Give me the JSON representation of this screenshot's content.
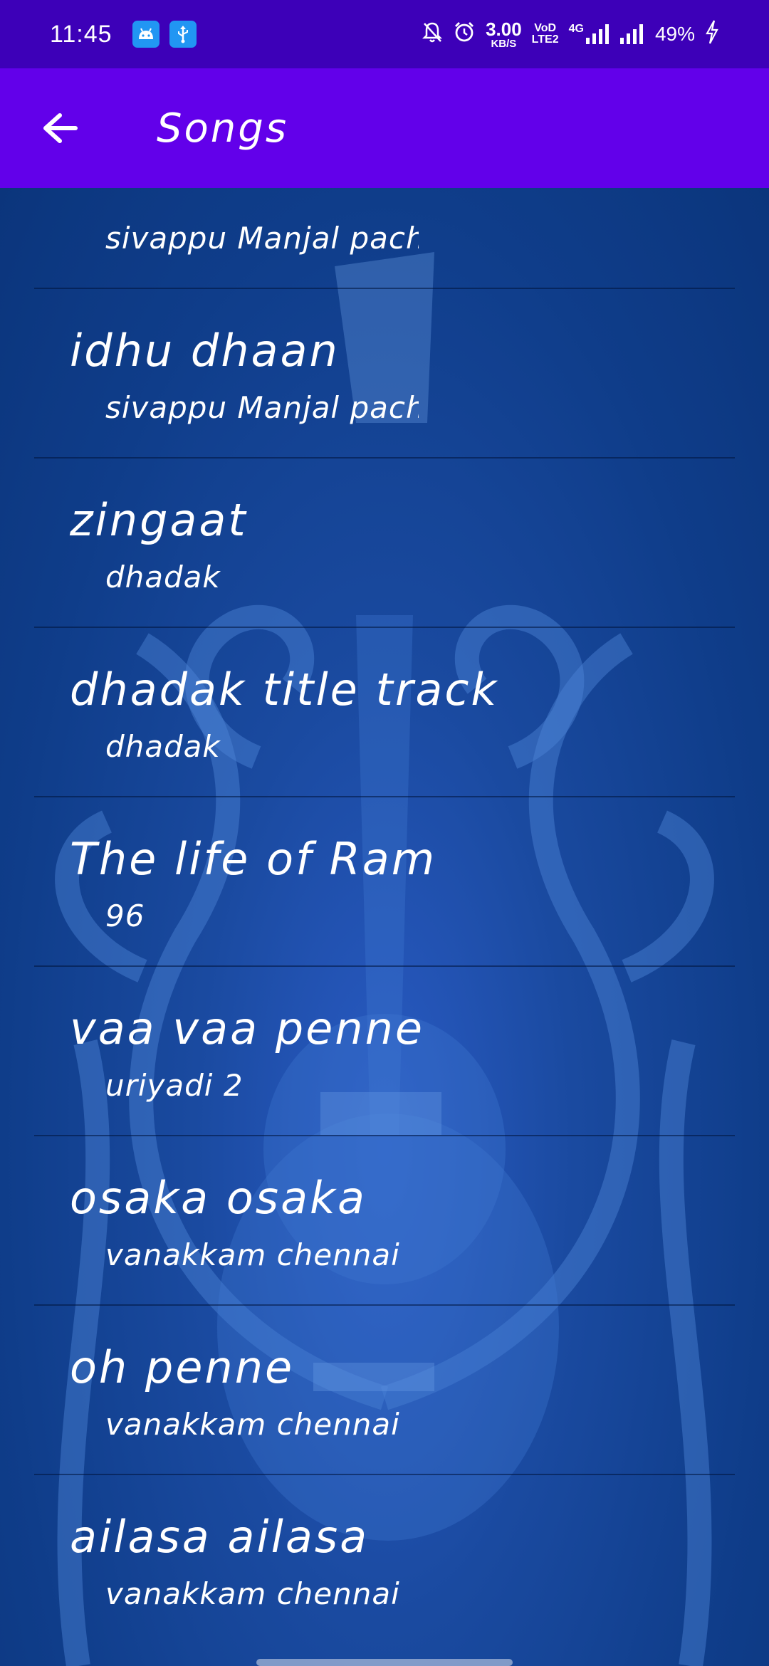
{
  "status_bar": {
    "time": "11:45",
    "speed_value": "3.00",
    "speed_unit": "KB/S",
    "volte_top": "VoD",
    "volte_bottom": "LTE2",
    "network": "4G",
    "battery": "49%",
    "icons": [
      "android-icon",
      "usb-icon",
      "bell-muted-icon",
      "alarm-icon",
      "signal-icon",
      "signal-icon",
      "charging-icon"
    ]
  },
  "app_bar": {
    "title": "Songs",
    "back_icon": "arrow-back-icon"
  },
  "songs": [
    {
      "title": "",
      "album": "sivappu Manjal pachai"
    },
    {
      "title": "idhu dhaan",
      "album": "sivappu Manjal pachai"
    },
    {
      "title": "zingaat",
      "album": "dhadak"
    },
    {
      "title": "dhadak title track",
      "album": "dhadak"
    },
    {
      "title": "The life of Ram",
      "album": "96"
    },
    {
      "title": "vaa vaa penne",
      "album": "uriyadi 2"
    },
    {
      "title": "osaka osaka",
      "album": "vanakkam chennai"
    },
    {
      "title": "oh penne",
      "album": "vanakkam chennai"
    },
    {
      "title": "ailasa ailasa",
      "album": "vanakkam chennai"
    }
  ],
  "colors": {
    "status_bar": "#3d00b8",
    "app_bar": "#6200ea",
    "background": "#0d3a82"
  }
}
